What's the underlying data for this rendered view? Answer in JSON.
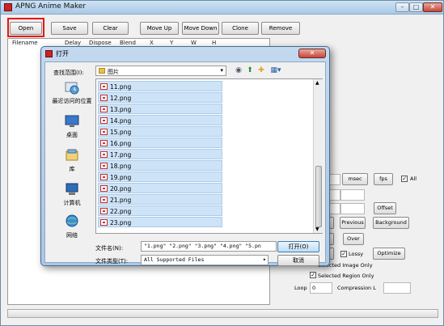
{
  "main_window": {
    "title": "APNG Anime Maker",
    "caption_buttons": {
      "minimize": "–",
      "maximize": "□",
      "close": "✕"
    }
  },
  "toolbar": {
    "open": "Open",
    "save": "Save",
    "clear": "Clear",
    "move_up": "Move Up",
    "move_down": "Move Down",
    "clone": "Clone",
    "remove": "Remove"
  },
  "file_list": {
    "columns": [
      "Filename",
      "Delay",
      "Dispose",
      "Blend",
      "X",
      "Y",
      "W",
      "H"
    ]
  },
  "right_panel": {
    "msec_label": "msec",
    "fps_label": "fps",
    "all_label": "All",
    "offset_label": "Offset",
    "previous_label": "Previous",
    "background_label": "Background",
    "over_label": "Over",
    "lossy_label": "Lossy",
    "optimize_label": "Optimize",
    "selected_image_only": "Selected Image Only",
    "selected_region_only": "Selected Region Only",
    "loop_label": "Loop",
    "loop_value": "0",
    "compression_label": "Compression L"
  },
  "open_dialog": {
    "title": "打开",
    "look_in_label": "查找范围(I):",
    "look_in_value": "图片",
    "places": [
      "最近访问的位置",
      "桌面",
      "库",
      "计算机",
      "网络"
    ],
    "files": [
      "11.png",
      "12.png",
      "13.png",
      "14.png",
      "15.png",
      "16.png",
      "17.png",
      "18.png",
      "19.png",
      "20.png",
      "21.png",
      "22.png",
      "23.png"
    ],
    "filename_label": "文件名(N):",
    "filename_value": "\"1.png\" \"2.png\" \"3.png\" \"4.png\" \"5.pn",
    "filetype_label": "文件类型(T):",
    "filetype_value": "All Supported Files",
    "open_button": "打开(O)",
    "cancel_button": "取消"
  },
  "colors": {
    "highlight_outline": "#e81313",
    "selected_row": "#cde3f7"
  }
}
